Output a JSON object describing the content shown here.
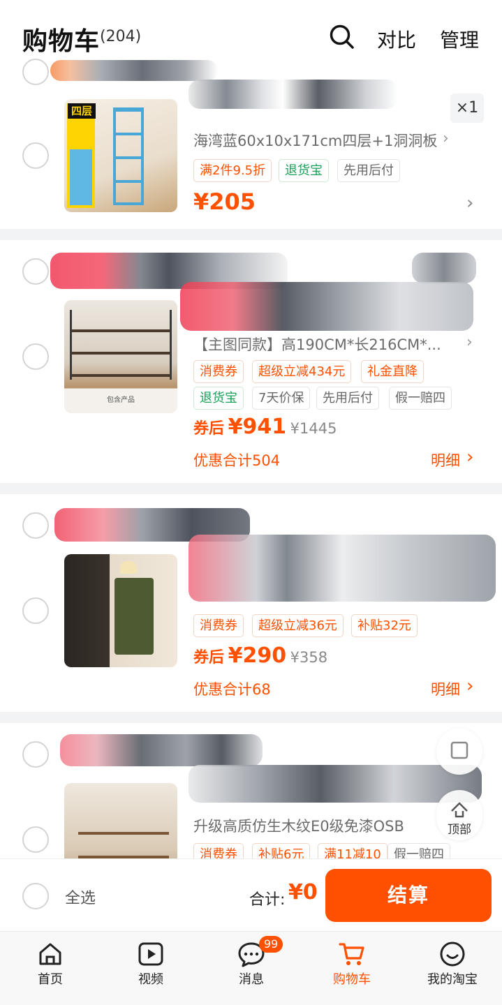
{
  "header": {
    "title": "购物车",
    "count": "(204)",
    "compare_label": "对比",
    "manage_label": "管理"
  },
  "items": [
    {
      "sku": "海湾蓝60x10x171cm四层+1洞洞板",
      "quantity": "×1",
      "tags": [
        "满2件9.5折",
        "退货宝",
        "先用后付"
      ],
      "price": "¥205",
      "thumb_text": "四层"
    },
    {
      "sku": "【主图同款】高190CM*长216CM*...",
      "tags": [
        "消费券",
        "超级立减434元",
        "礼金直降",
        "退货宝",
        "7天价保",
        "先用后付",
        "假一赔四"
      ],
      "price_prefix": "券后",
      "price": "¥941",
      "original_price": "¥1445",
      "discount_total": "优惠合计504",
      "detail_label": "明细",
      "thumb_text": "包含产品"
    },
    {
      "tags": [
        "消费券",
        "超级立减36元",
        "补贴32元"
      ],
      "price_prefix": "券后",
      "price": "¥290",
      "original_price": "¥358",
      "discount_total": "优惠合计68",
      "detail_label": "明细"
    },
    {
      "sku": "升级高质仿生木纹E0级免漆OSB",
      "tags": [
        "消费券",
        "补贴6元",
        "满11减10",
        "假一赔四"
      ]
    }
  ],
  "float_top_label": "顶部",
  "checkout": {
    "select_all_label": "全选",
    "total_label": "合计:",
    "total_value": "¥0",
    "checkout_label": "结算"
  },
  "nav": [
    {
      "label": "首页",
      "icon": "home-icon"
    },
    {
      "label": "视频",
      "icon": "video-icon"
    },
    {
      "label": "消息",
      "icon": "message-icon",
      "badge": "99"
    },
    {
      "label": "购物车",
      "icon": "cart-icon",
      "active": true
    },
    {
      "label": "我的淘宝",
      "icon": "profile-icon"
    }
  ],
  "colors": {
    "accent": "#ff5000",
    "green": "#18a058"
  }
}
